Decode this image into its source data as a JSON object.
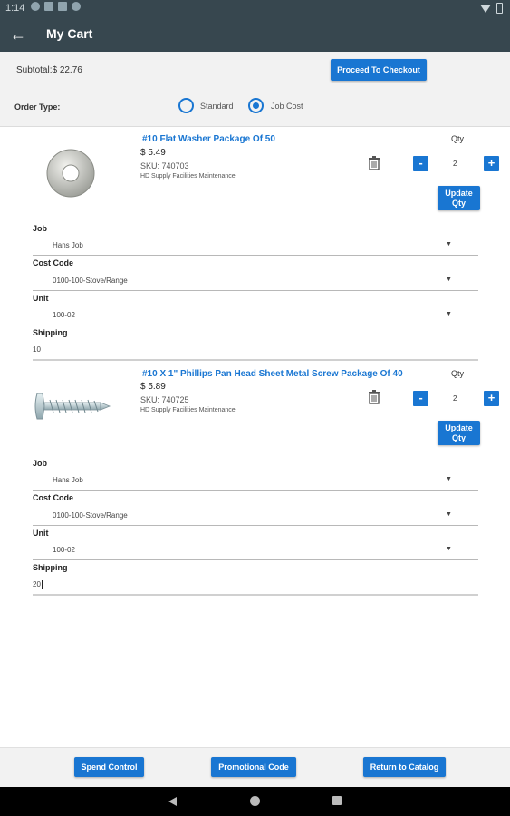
{
  "status_bar": {
    "time": "1:14"
  },
  "app_bar": {
    "title": "My Cart"
  },
  "summary": {
    "subtotal": "Subtotal:$ 22.76",
    "checkout_label": "Proceed To Checkout",
    "order_type_label": "Order Type:",
    "order_types": [
      {
        "label": "Standard",
        "selected": false
      },
      {
        "label": "Job Cost",
        "selected": true
      }
    ]
  },
  "items": [
    {
      "title": "#10 Flat Washer Package Of 50",
      "price": "$ 5.49",
      "sku": "SKU: 740703",
      "vendor": "HD Supply Facilities Maintenance",
      "qty_label": "Qty",
      "qty": "2",
      "minus_label": "-",
      "plus_label": "+",
      "update_label_1": "Update",
      "update_label_2": "Qty",
      "fields": {
        "job_label": "Job",
        "job_value": "Hans Job",
        "cost_code_label": "Cost Code",
        "cost_code_value": "0100-100-Stove/Range",
        "unit_label": "Unit",
        "unit_value": "100-02",
        "shipping_label": "Shipping",
        "shipping_value": "10"
      }
    },
    {
      "title": "#10 X 1\" Phillips Pan Head Sheet Metal Screw Package Of 40",
      "price": "$ 5.89",
      "sku": "SKU: 740725",
      "vendor": "HD Supply Facilities Maintenance",
      "qty_label": "Qty",
      "qty": "2",
      "minus_label": "-",
      "plus_label": "+",
      "update_label_1": "Update",
      "update_label_2": "Qty",
      "fields": {
        "job_label": "Job",
        "job_value": "Hans Job",
        "cost_code_label": "Cost Code",
        "cost_code_value": "0100-100-Stove/Range",
        "unit_label": "Unit",
        "unit_value": "100-02",
        "shipping_label": "Shipping",
        "shipping_value": "20"
      }
    }
  ],
  "bottom_bar": {
    "spend_control_label": "Spend Control",
    "promo_code_label": "Promotional Code",
    "return_label": "Return to Catalog"
  },
  "colors": {
    "accent": "#1976d2",
    "app_bar": "#37474f"
  }
}
